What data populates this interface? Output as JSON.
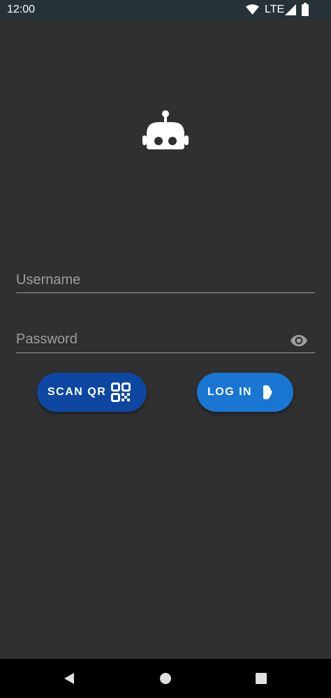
{
  "status_bar": {
    "time": "12:00",
    "network": "LTE",
    "icons": [
      "wifi-icon",
      "cell-signal-icon",
      "battery-icon"
    ]
  },
  "logo": {
    "icon": "robot-icon"
  },
  "form": {
    "username_placeholder": "Username",
    "username_value": "",
    "password_placeholder": "Password",
    "password_value": "",
    "password_toggle_icon": "eye-icon"
  },
  "buttons": {
    "scan_label": "SCAN QR",
    "scan_icon": "qr-code-icon",
    "login_label": "LOG IN",
    "login_icon": "arrow-right-icon"
  },
  "nav_bar": {
    "icons": [
      "back-icon",
      "home-icon",
      "recents-icon"
    ]
  },
  "colors": {
    "background": "#303030",
    "status_bar": "#263238",
    "scan_button": "#0d47a1",
    "login_button": "#1976d2"
  }
}
